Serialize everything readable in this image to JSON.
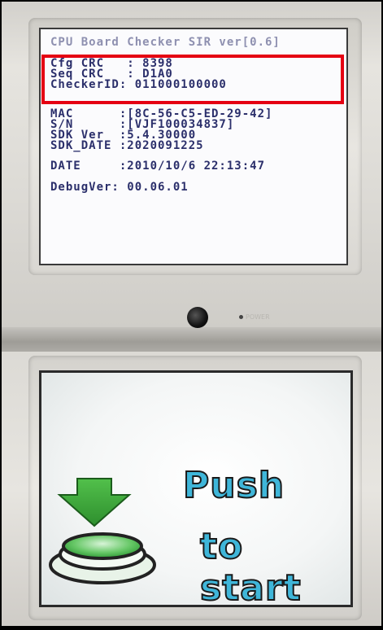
{
  "top_screen": {
    "title_partial": "CPU Board Checker SIR ver[0.6]",
    "lines": {
      "cfg_crc": "Cfg CRC   : 8398",
      "seq_crc": "Seq CRC   : D1A0",
      "checker_id": "CheckerID: 011000100000",
      "mac": "MAC      :[8C-56-C5-ED-29-42]",
      "sn": "S/N      :[VJF100034837]",
      "sdk_ver": "SDK Ver  :5.4.30000",
      "sdk_date": "SDK_DATE :2020091225",
      "date": "DATE     :2010/10/6 22:13:47",
      "debug_ver": "DebugVer: 00.06.01"
    }
  },
  "hinge": {
    "led_label": "POWER"
  },
  "bottom_screen": {
    "push_label": "Push",
    "start_label": "to start",
    "arrow_icon": "down-arrow-icon",
    "button_icon": "round-button-icon"
  },
  "colors": {
    "highlight": "#e50012",
    "text_blue": "#2b2f6b",
    "push_text": "#3fb6d9",
    "arrow_green": "#3aa83a"
  }
}
